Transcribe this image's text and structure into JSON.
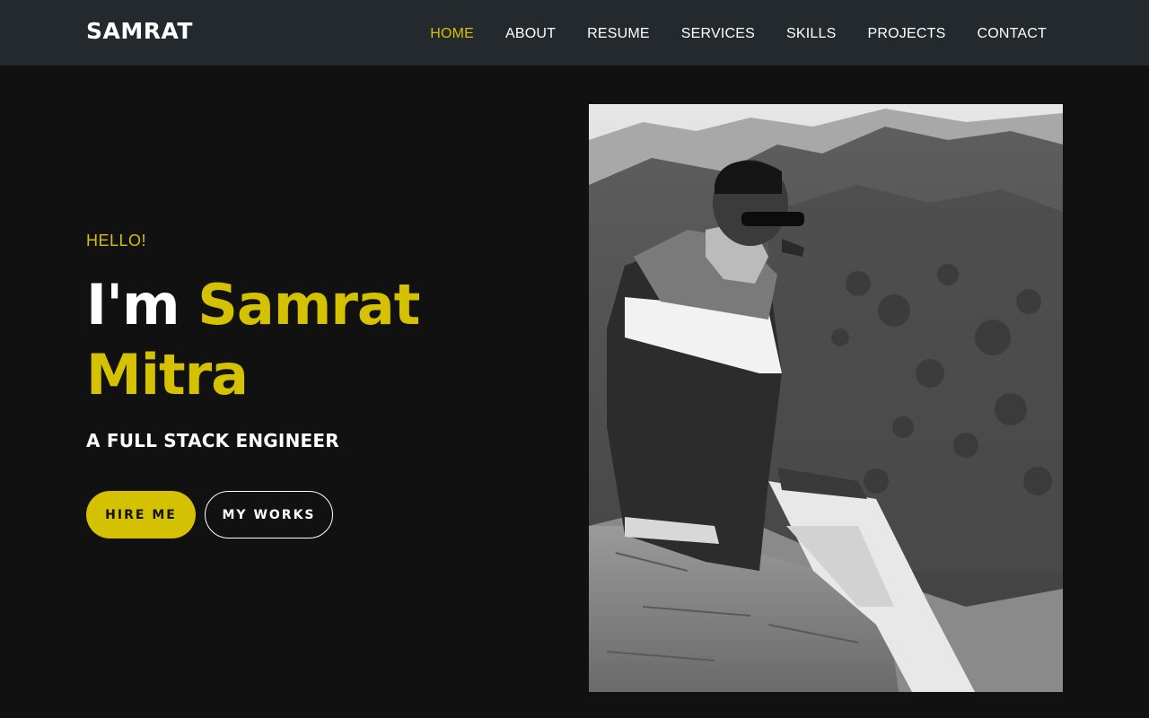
{
  "header": {
    "brand": "SAMRAT",
    "nav": [
      {
        "label": "HOME",
        "active": true
      },
      {
        "label": "ABOUT"
      },
      {
        "label": "RESUME"
      },
      {
        "label": "SERVICES"
      },
      {
        "label": "SKILLS"
      },
      {
        "label": "PROJECTS"
      },
      {
        "label": "CONTACT"
      }
    ]
  },
  "hero": {
    "greeting": "HELLO!",
    "headline_lead": "I'm",
    "headline_name": "Samrat Mitra",
    "subtitle": "A FULL STACK ENGINEER",
    "hire_label": "HIRE ME",
    "works_label": "MY WORKS"
  },
  "colors": {
    "accent": "#d4c100",
    "navbar_bg": "#23292d",
    "page_bg": "#111111",
    "text": "#ffffff"
  }
}
